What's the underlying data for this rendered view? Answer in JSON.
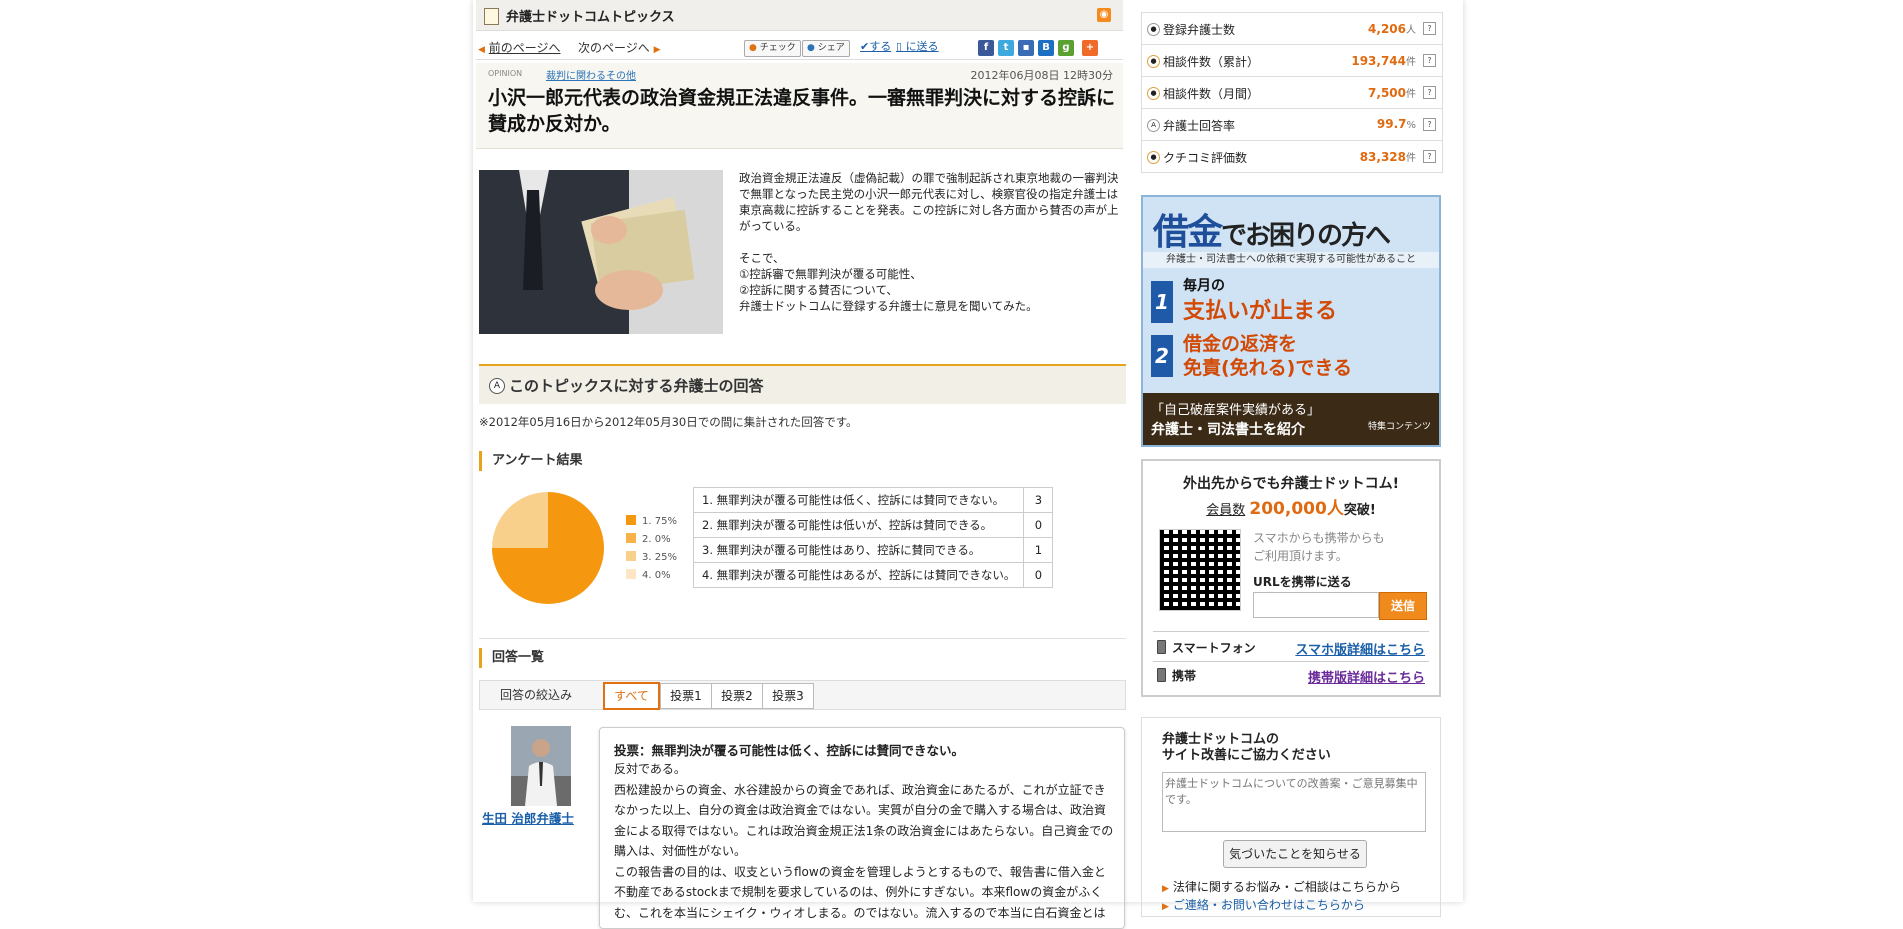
{
  "header": {
    "title": "弁護士ドットコムトピックス",
    "rss_label": "RSS"
  },
  "nav": {
    "prev": "前のページへ",
    "next": "次のページへ",
    "check": "チェック",
    "share": "シェア",
    "suru": "する",
    "okuru": "に送る"
  },
  "article": {
    "opinion_label": "OPINION",
    "category": "裁判に関わるその他",
    "date": "2012年06月08日 12時30分",
    "title": "小沢一郎元代表の政治資金規正法違反事件。一審無罪判決に対する控訴に賛成か反対か。",
    "lead": [
      "政治資金規正法違反（虚偽記載）の罪で強制起訴され東京地裁の一審判決で無罪となった民主党の小沢一郎元代表に対し、検察官役の指定弁護士は東京高裁に控訴することを発表。この控訴に対し各方面から賛否の声が上がっている。",
      "",
      "そこで、",
      "①控訴審で無罪判決が覆る可能性、",
      "②控訴に関する賛否について、",
      "弁護士ドットコムに登録する弁護士に意見を聞いてみた。"
    ]
  },
  "answers_section": {
    "title": "このトピックスに対する弁護士の回答",
    "period": "※2012年05月16日から2012年05月30日での間に集計された回答です。",
    "survey_title": "アンケート結果",
    "list_title": "回答一覧",
    "filter_label": "回答の絞込み",
    "tabs": [
      "すべて",
      "投票1",
      "投票2",
      "投票3"
    ]
  },
  "chart_data": {
    "type": "pie",
    "categories": [
      "1.",
      "2.",
      "3.",
      "4."
    ],
    "values": [
      0.75,
      0.0,
      0.25,
      0.0
    ],
    "legend": [
      "1. 75%",
      "2. 0%",
      "3. 25%",
      "4. 0%"
    ],
    "colors": [
      "#f5970f",
      "#f7b24a",
      "#f9cf8c",
      "#fce6c4"
    ]
  },
  "survey_rows": [
    {
      "label": "1. 無罪判決が覆る可能性は低く、控訴には賛同できない。",
      "count": "3"
    },
    {
      "label": "2. 無罪判決が覆る可能性は低いが、控訴は賛同できる。",
      "count": "0"
    },
    {
      "label": "3. 無罪判決が覆る可能性はあり、控訴に賛同できる。",
      "count": "1"
    },
    {
      "label": "4. 無罪判決が覆る可能性はあるが、控訴には賛同できない。",
      "count": "0"
    }
  ],
  "answer": {
    "lawyer_name": "生田 治郎弁護士",
    "vote": "投票：無罪判決が覆る可能性は低く、控訴には賛同できない。",
    "body": [
      "反対である。",
      "西松建設からの資金、水谷建設からの資金であれば、政治資金にあたるが、これが立証できなかった以上、自分の資金は政治資金ではない。実質が自分の金で購入する場合は、政治資金による取得ではない。これは政治資金規正法1条の政治資金にはあたらない。自己資金での購入は、対価性がない。",
      "この報告書の目的は、収支というflowの資金を管理しようとするもので、報告書に借入金と不動産であるstockまで規制を要求しているのは、例外にすぎない。本来flowの資金がふくむ、これを本当にシェイク・ウィオしまる。のではない。流入するので本当に白石資金とは"
    ]
  },
  "stats": [
    {
      "icon": "person-icon",
      "label": "登録弁護士数",
      "value": "4,206",
      "unit": "人"
    },
    {
      "icon": "coin-icon",
      "label": "相談件数（累計）",
      "value": "193,744",
      "unit": "件"
    },
    {
      "icon": "coin-icon",
      "label": "相談件数（月間）",
      "value": "7,500",
      "unit": "件"
    },
    {
      "icon": "a-icon",
      "label": "弁護士回答率",
      "value": "99.7",
      "unit": "%"
    },
    {
      "icon": "chat-icon",
      "label": "クチコミ評価数",
      "value": "83,328",
      "unit": "件"
    }
  ],
  "ad": {
    "headline_a": "借金",
    "headline_b": "でお困りの方へ",
    "sub": "弁護士・司法書士への依頼で実現する可能性があること",
    "item1_small": "毎月の",
    "item1_big": "支払いが止まる",
    "item2_small": "借金の返済を",
    "item2_big": "免責(免れる)できる",
    "foot_a": "「自己破産案件実績がある」",
    "foot_b": "弁護士・司法書士を紹介",
    "foot_c": "特集コンテンツ"
  },
  "mobile": {
    "title": "外出先からでも弁護士ドットコム!",
    "members_prefix": "会員数",
    "members_value": "200,000人",
    "members_suffix": "突破!",
    "desc1": "スマホからも携帯からも",
    "desc2": "ご利用頂けます。",
    "url_label": "URLを携帯に送る",
    "send": "送信",
    "smartphone": "スマートフォン",
    "smartphone_link": "スマホ版詳細はこちら",
    "keitai": "携帯",
    "keitai_link": "携帯版詳細はこちら"
  },
  "feedback": {
    "title1": "弁護士ドットコムの",
    "title2": "サイト改善にご協力ください",
    "placeholder": "弁護士ドットコムについての改善案・ご意見募集中です。",
    "button": "気づいたことを知らせる",
    "link1": "法律に関するお悩み・ご相談はこちらから",
    "link2": "ご連絡・お問い合わせはこちらから"
  }
}
